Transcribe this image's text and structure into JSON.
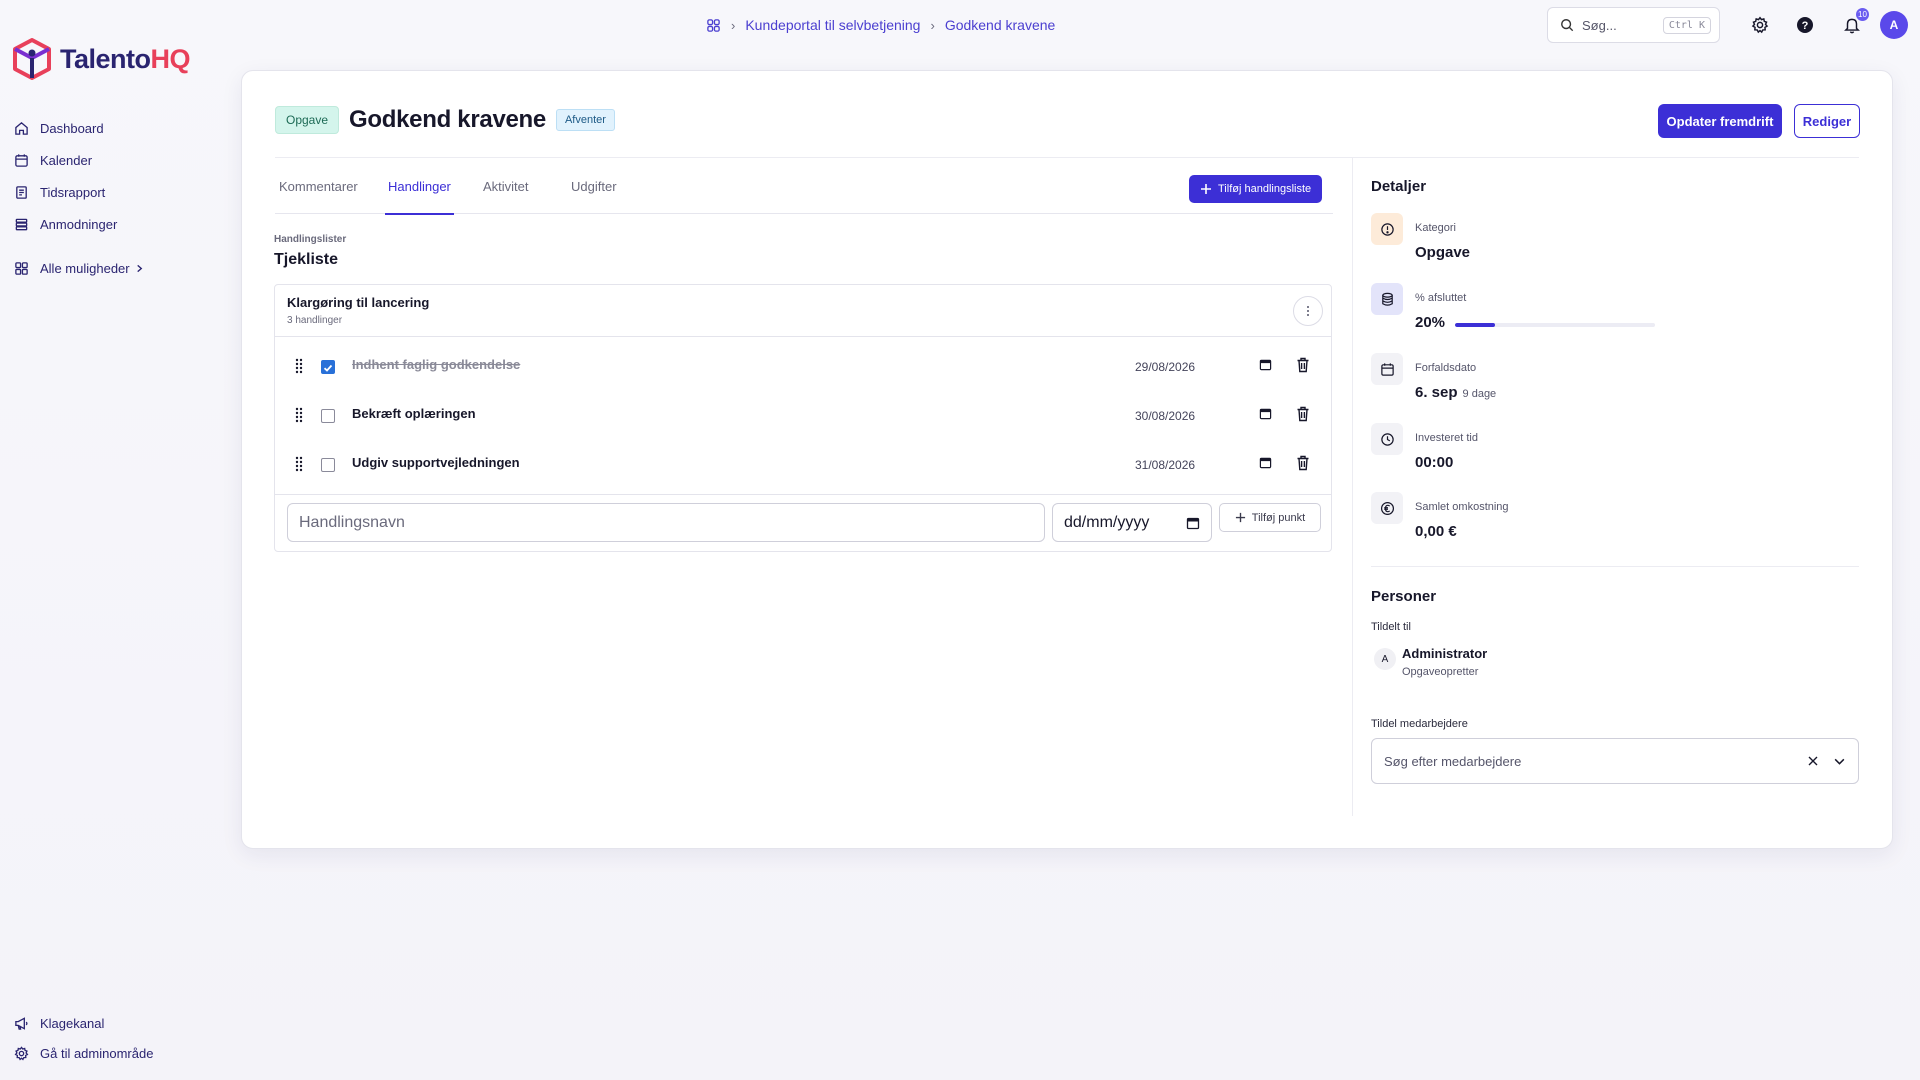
{
  "app": {
    "logo_part1": "Talento",
    "logo_part2": "HQ",
    "brand_color": "#2a2470",
    "brand_accent": "#e8405a",
    "primary_color": "#3c2fd6"
  },
  "sidebar": {
    "items": [
      {
        "label": "Dashboard",
        "icon": "home-icon"
      },
      {
        "label": "Kalender",
        "icon": "calendar-icon"
      },
      {
        "label": "Tidsrapport",
        "icon": "timesheet-icon"
      },
      {
        "label": "Anmodninger",
        "icon": "list-icon"
      }
    ],
    "more_label": "Alle muligheder",
    "bottom": [
      {
        "label": "Klagekanal",
        "icon": "megaphone-icon"
      },
      {
        "label": "Gå til adminområde",
        "icon": "gear-icon"
      }
    ]
  },
  "topbar": {
    "breadcrumb": [
      "Kundeportal til selvbetjening",
      "Godkend kravene"
    ],
    "search_placeholder": "Søg...",
    "search_shortcut": "Ctrl K",
    "notification_count": "10",
    "avatar_initial": "A"
  },
  "task": {
    "type_tag": "Opgave",
    "title": "Godkend kravene",
    "status": "Afventer",
    "update_progress_label": "Opdater fremdrift",
    "edit_label": "Rediger"
  },
  "tabs": [
    {
      "label": "Kommentarer",
      "active": false
    },
    {
      "label": "Handlinger",
      "active": true
    },
    {
      "label": "Aktivitet",
      "active": false
    },
    {
      "label": "Udgifter",
      "active": false
    }
  ],
  "actions": {
    "add_list_label": "Tilføj handlingsliste",
    "section_label": "Handlingslister",
    "section_title": "Tjekliste",
    "list": {
      "name": "Klargøring til lancering",
      "count": "3 handlinger",
      "items": [
        {
          "text": "Indhent faglig godkendelse",
          "date": "29/08/2026",
          "done": true
        },
        {
          "text": "Bekræft oplæringen",
          "date": "30/08/2026",
          "done": false
        },
        {
          "text": "Udgiv supportvejledningen",
          "date": "31/08/2026",
          "done": false
        }
      ]
    },
    "new_item_placeholder": "Handlingsnavn",
    "new_item_date_placeholder": "dd/mm/yyyy",
    "add_item_label": "Tilføj punkt"
  },
  "details": {
    "title": "Detaljer",
    "category_label": "Kategori",
    "category_value": "Opgave",
    "completed_label": "% afsluttet",
    "completed_value": "20%",
    "completed_fraction": 0.2,
    "due_label": "Forfaldsdato",
    "due_value": "6. sep",
    "due_sub": "9 dage",
    "time_label": "Investeret tid",
    "time_value": "00:00",
    "cost_label": "Samlet omkostning",
    "cost_value": "0,00 €"
  },
  "people": {
    "title": "Personer",
    "assigned_label": "Tildelt til",
    "assignee_initial": "A",
    "assignee_name": "Administrator",
    "assignee_role": "Opgaveopretter",
    "assign_label": "Tildel medarbejdere",
    "assign_placeholder": "Søg efter medarbejdere"
  }
}
